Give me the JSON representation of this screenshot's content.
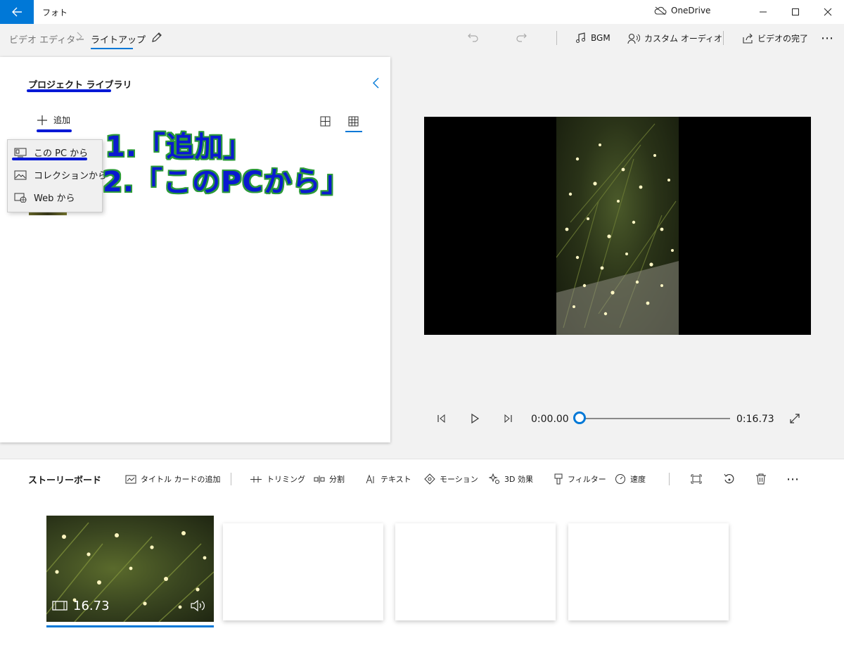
{
  "app": {
    "title": "フォト",
    "onedrive": "OneDrive"
  },
  "breadcrumb": {
    "parent": "ビデオ エディター",
    "current": "ライトアップ"
  },
  "toolbar": {
    "bgm": "BGM",
    "custom_audio": "カスタム オーディオ",
    "finish": "ビデオの完了"
  },
  "library": {
    "title": "プロジェクト ライブラリ",
    "add_label": "追加",
    "menu": [
      "この PC から",
      "コレクションから",
      "Web から"
    ]
  },
  "annotation": {
    "line1": "1.「追加」",
    "line2": "2.「このPCから」"
  },
  "playback": {
    "current": "0:00.00",
    "end": "0:16.73",
    "progress": 0
  },
  "storyboard": {
    "title": "ストーリーボード",
    "tools": [
      "タイトル カードの追加",
      "トリミング",
      "分割",
      "テキスト",
      "モーション",
      "3D 効果",
      "フィルター",
      "速度"
    ],
    "clip_duration": "16.73"
  },
  "colors": {
    "accent": "#0078d7",
    "annotation_text": "#0a1ad0",
    "annotation_outline": "#2d9a3a"
  }
}
